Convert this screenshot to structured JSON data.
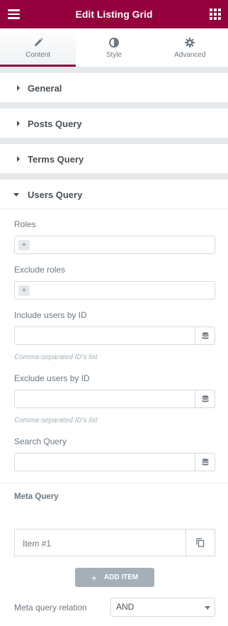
{
  "header": {
    "title": "Edit Listing Grid"
  },
  "tabs": [
    {
      "label": "Content",
      "active": true,
      "icon": "pencil-icon"
    },
    {
      "label": "Style",
      "active": false,
      "icon": "half-circle-icon"
    },
    {
      "label": "Advanced",
      "active": false,
      "icon": "gear-icon"
    }
  ],
  "sections": {
    "general": "General",
    "posts_query": "Posts Query",
    "terms_query": "Terms Query",
    "users_query": "Users Query"
  },
  "users_query": {
    "roles_label": "Roles",
    "exclude_roles_label": "Exclude roles",
    "include_ids_label": "Include users by ID",
    "include_ids_value": "",
    "include_ids_desc": "Comma-separated ID's list",
    "exclude_ids_label": "Exclude users by ID",
    "exclude_ids_value": "",
    "exclude_ids_desc": "Comma-separated ID's list",
    "search_label": "Search Query",
    "search_value": ""
  },
  "meta_query": {
    "title": "Meta Query",
    "items": [
      {
        "title": "Item #1"
      }
    ],
    "add_label": "ADD ITEM",
    "relation_label": "Meta query relation",
    "relation_value": "AND"
  },
  "colors": {
    "brand": "#93003c",
    "muted": "#a4afb7"
  }
}
